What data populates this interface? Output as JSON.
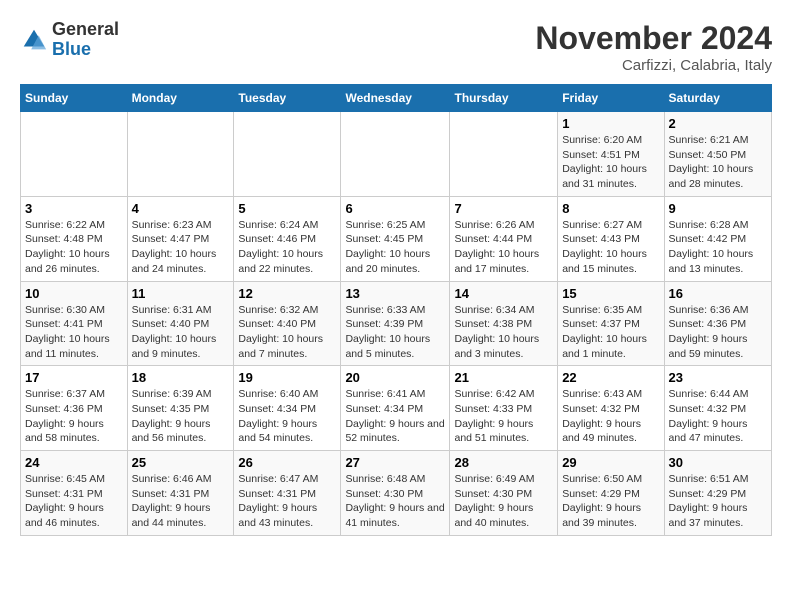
{
  "header": {
    "logo_general": "General",
    "logo_blue": "Blue",
    "month_title": "November 2024",
    "subtitle": "Carfizzi, Calabria, Italy"
  },
  "weekdays": [
    "Sunday",
    "Monday",
    "Tuesday",
    "Wednesday",
    "Thursday",
    "Friday",
    "Saturday"
  ],
  "weeks": [
    [
      {
        "day": "",
        "info": ""
      },
      {
        "day": "",
        "info": ""
      },
      {
        "day": "",
        "info": ""
      },
      {
        "day": "",
        "info": ""
      },
      {
        "day": "",
        "info": ""
      },
      {
        "day": "1",
        "info": "Sunrise: 6:20 AM\nSunset: 4:51 PM\nDaylight: 10 hours and 31 minutes."
      },
      {
        "day": "2",
        "info": "Sunrise: 6:21 AM\nSunset: 4:50 PM\nDaylight: 10 hours and 28 minutes."
      }
    ],
    [
      {
        "day": "3",
        "info": "Sunrise: 6:22 AM\nSunset: 4:48 PM\nDaylight: 10 hours and 26 minutes."
      },
      {
        "day": "4",
        "info": "Sunrise: 6:23 AM\nSunset: 4:47 PM\nDaylight: 10 hours and 24 minutes."
      },
      {
        "day": "5",
        "info": "Sunrise: 6:24 AM\nSunset: 4:46 PM\nDaylight: 10 hours and 22 minutes."
      },
      {
        "day": "6",
        "info": "Sunrise: 6:25 AM\nSunset: 4:45 PM\nDaylight: 10 hours and 20 minutes."
      },
      {
        "day": "7",
        "info": "Sunrise: 6:26 AM\nSunset: 4:44 PM\nDaylight: 10 hours and 17 minutes."
      },
      {
        "day": "8",
        "info": "Sunrise: 6:27 AM\nSunset: 4:43 PM\nDaylight: 10 hours and 15 minutes."
      },
      {
        "day": "9",
        "info": "Sunrise: 6:28 AM\nSunset: 4:42 PM\nDaylight: 10 hours and 13 minutes."
      }
    ],
    [
      {
        "day": "10",
        "info": "Sunrise: 6:30 AM\nSunset: 4:41 PM\nDaylight: 10 hours and 11 minutes."
      },
      {
        "day": "11",
        "info": "Sunrise: 6:31 AM\nSunset: 4:40 PM\nDaylight: 10 hours and 9 minutes."
      },
      {
        "day": "12",
        "info": "Sunrise: 6:32 AM\nSunset: 4:40 PM\nDaylight: 10 hours and 7 minutes."
      },
      {
        "day": "13",
        "info": "Sunrise: 6:33 AM\nSunset: 4:39 PM\nDaylight: 10 hours and 5 minutes."
      },
      {
        "day": "14",
        "info": "Sunrise: 6:34 AM\nSunset: 4:38 PM\nDaylight: 10 hours and 3 minutes."
      },
      {
        "day": "15",
        "info": "Sunrise: 6:35 AM\nSunset: 4:37 PM\nDaylight: 10 hours and 1 minute."
      },
      {
        "day": "16",
        "info": "Sunrise: 6:36 AM\nSunset: 4:36 PM\nDaylight: 9 hours and 59 minutes."
      }
    ],
    [
      {
        "day": "17",
        "info": "Sunrise: 6:37 AM\nSunset: 4:36 PM\nDaylight: 9 hours and 58 minutes."
      },
      {
        "day": "18",
        "info": "Sunrise: 6:39 AM\nSunset: 4:35 PM\nDaylight: 9 hours and 56 minutes."
      },
      {
        "day": "19",
        "info": "Sunrise: 6:40 AM\nSunset: 4:34 PM\nDaylight: 9 hours and 54 minutes."
      },
      {
        "day": "20",
        "info": "Sunrise: 6:41 AM\nSunset: 4:34 PM\nDaylight: 9 hours and 52 minutes."
      },
      {
        "day": "21",
        "info": "Sunrise: 6:42 AM\nSunset: 4:33 PM\nDaylight: 9 hours and 51 minutes."
      },
      {
        "day": "22",
        "info": "Sunrise: 6:43 AM\nSunset: 4:32 PM\nDaylight: 9 hours and 49 minutes."
      },
      {
        "day": "23",
        "info": "Sunrise: 6:44 AM\nSunset: 4:32 PM\nDaylight: 9 hours and 47 minutes."
      }
    ],
    [
      {
        "day": "24",
        "info": "Sunrise: 6:45 AM\nSunset: 4:31 PM\nDaylight: 9 hours and 46 minutes."
      },
      {
        "day": "25",
        "info": "Sunrise: 6:46 AM\nSunset: 4:31 PM\nDaylight: 9 hours and 44 minutes."
      },
      {
        "day": "26",
        "info": "Sunrise: 6:47 AM\nSunset: 4:31 PM\nDaylight: 9 hours and 43 minutes."
      },
      {
        "day": "27",
        "info": "Sunrise: 6:48 AM\nSunset: 4:30 PM\nDaylight: 9 hours and 41 minutes."
      },
      {
        "day": "28",
        "info": "Sunrise: 6:49 AM\nSunset: 4:30 PM\nDaylight: 9 hours and 40 minutes."
      },
      {
        "day": "29",
        "info": "Sunrise: 6:50 AM\nSunset: 4:29 PM\nDaylight: 9 hours and 39 minutes."
      },
      {
        "day": "30",
        "info": "Sunrise: 6:51 AM\nSunset: 4:29 PM\nDaylight: 9 hours and 37 minutes."
      }
    ]
  ]
}
